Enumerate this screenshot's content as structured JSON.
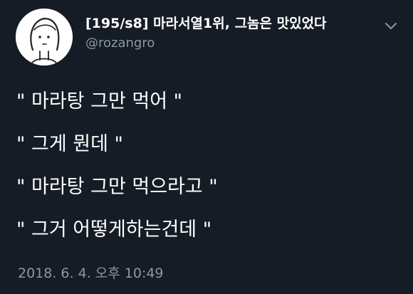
{
  "tweet": {
    "display_name": "[195/s8] 마라서열1위, 그놈은 맛있었다",
    "handle": "@rozangro",
    "lines": [
      "\" 마라탕 그만 먹어 \"",
      "\" 그게 뭔데 \"",
      "\" 마라탕 그만 먹으라고 \"",
      "\" 그거 어떻게하는건데 \""
    ],
    "timestamp": "2018. 6. 4. 오후 10:49"
  },
  "icons": {
    "avatar": "cartoon-face-avatar",
    "menu": "chevron-down-icon"
  },
  "colors": {
    "background": "#151c26",
    "text_primary": "#ffffff",
    "text_secondary": "#8899a6"
  }
}
